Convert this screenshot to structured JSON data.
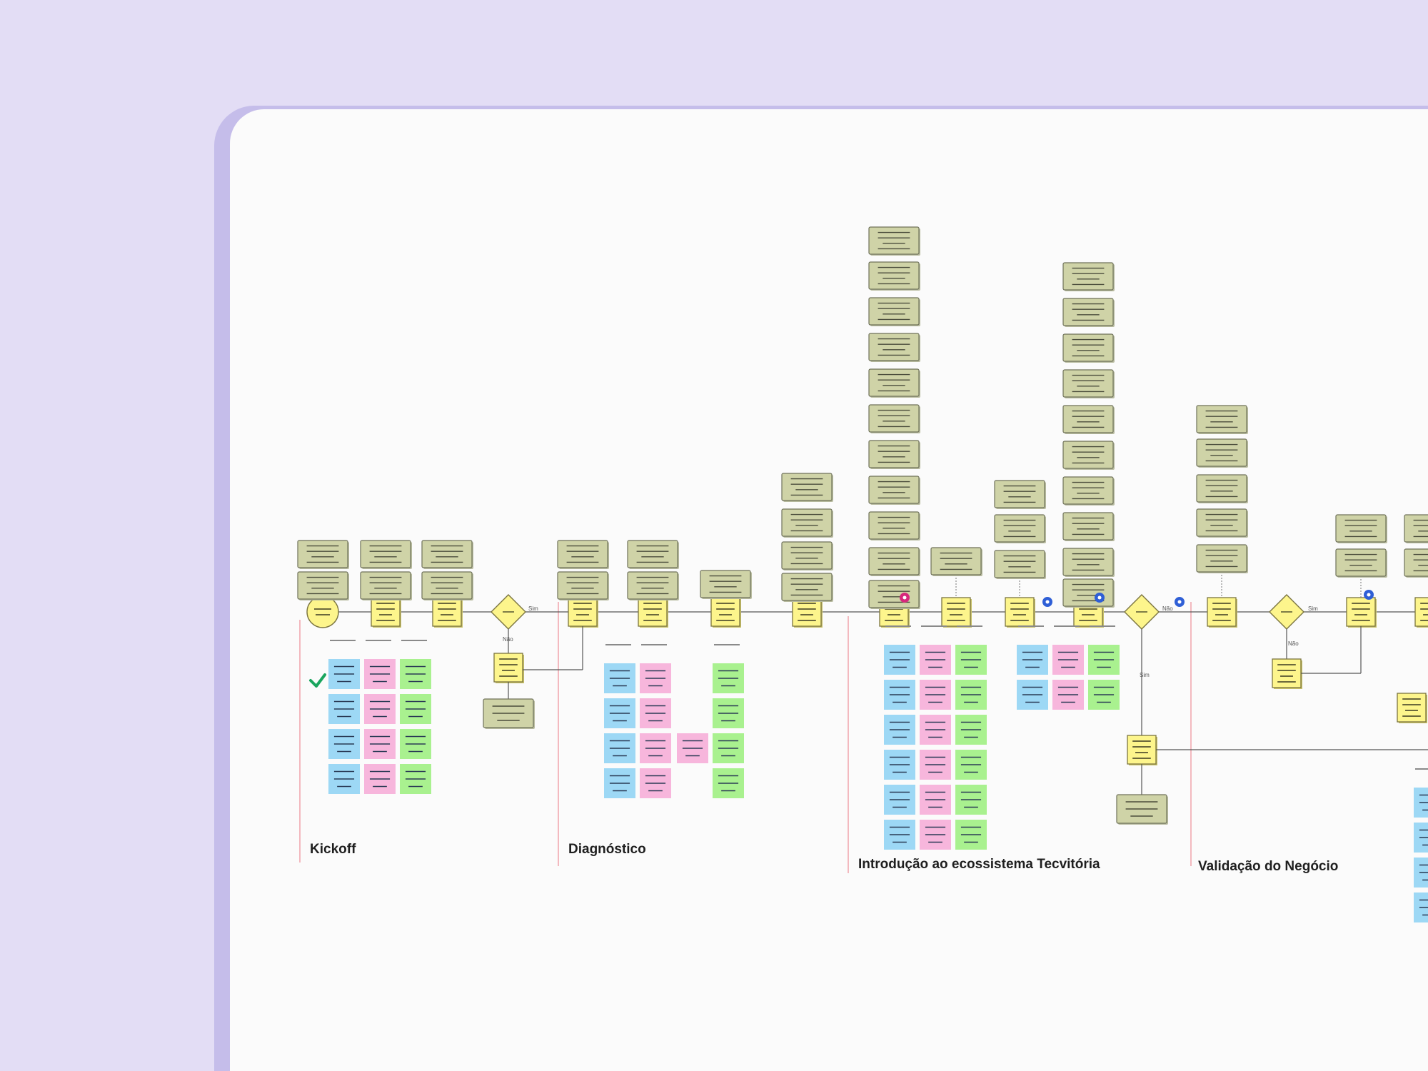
{
  "phases": [
    {
      "title": "Kickoff"
    },
    {
      "title": "Diagnóstico"
    },
    {
      "title": "Introdução ao ecossistema Tecvitória"
    },
    {
      "title": "Validação do Negócio"
    }
  ],
  "flow_labels": {
    "sim": "Sim",
    "nao": "Não"
  },
  "colors": {
    "background": "#e3ddf5",
    "frame": "#c5bdea",
    "canvas": "#fbfbfb",
    "process_step": "#fdf58c",
    "process_step_border": "#7a7440",
    "annotation_note": "#cfd3a7",
    "note_border": "#6f725a",
    "sticky_blue": "#9dd8f5",
    "sticky_pink": "#f7b6dc",
    "sticky_green": "#a9f18f",
    "phase_divider": "#f3b9bf",
    "connector": "#555555",
    "check": "#1aa55e",
    "marker_blue": "#2f5fd6",
    "marker_pink": "#d6287c"
  }
}
